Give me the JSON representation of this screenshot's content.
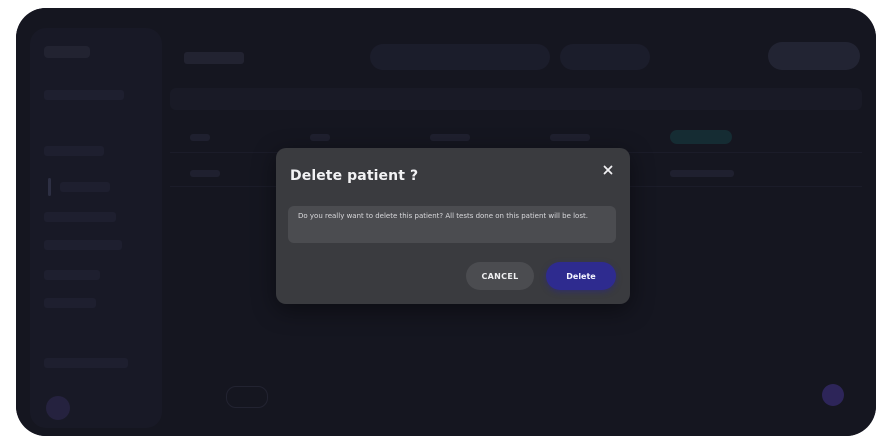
{
  "modal": {
    "title": "Delete patient ?",
    "message": "Do you really want to delete this patient? All tests done on this patient will be lost.",
    "cancel_label": "CANCEL",
    "delete_label": "Delete",
    "close_icon": "close-icon"
  },
  "colors": {
    "modal_bg": "#3a3b3f",
    "message_bg": "#4b4c50",
    "delete_accent": "#2e2b8f",
    "app_bg": "#161722"
  }
}
